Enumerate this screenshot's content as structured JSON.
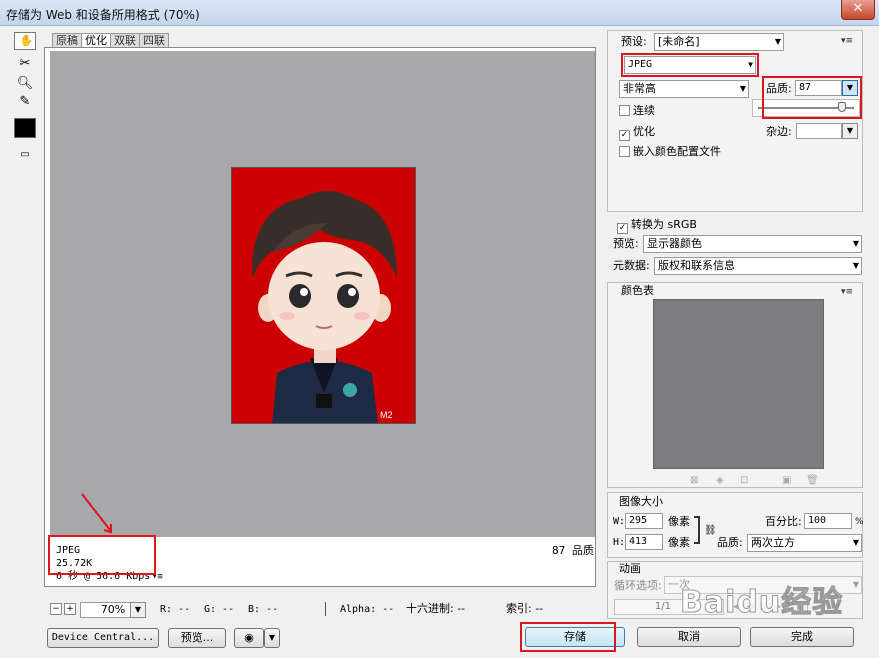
{
  "window": {
    "title": "存储为 Web 和设备所用格式 (70%)"
  },
  "tabs": [
    "原稿",
    "优化",
    "双联",
    "四联"
  ],
  "info": {
    "format": "JPEG",
    "size": "25.72K",
    "speed": "6 秒 @ 56.6 Kbps",
    "quality_note": "87 品质"
  },
  "photo": {
    "corner_mark": "M2"
  },
  "statusbar": {
    "zoom": "70%",
    "r": "R: --",
    "g": "G: --",
    "b": "B: --",
    "alpha": "Alpha: --",
    "hex": "十六进制: --",
    "index": "索引: --"
  },
  "buttons": {
    "device_central": "Device Central...",
    "preview": "预览...",
    "save": "存储",
    "cancel": "取消",
    "done": "完成"
  },
  "settings": {
    "preset_label": "预设:",
    "preset_value": "[未命名]",
    "format": "JPEG",
    "quality_level": "非常高",
    "quality_label": "品质:",
    "quality_value": "87",
    "quality_fraction": 0.87,
    "progressive": "连续",
    "optimized": "优化",
    "embed_profile": "嵌入颜色配置文件",
    "matte_label": "杂边:",
    "convert_srgb": "转换为 sRGB",
    "preview_label": "预览:",
    "preview_value": "显示器颜色",
    "metadata_label": "元数据:",
    "metadata_value": "版权和联系信息"
  },
  "color_table": {
    "title": "颜色表"
  },
  "image_size": {
    "title": "图像大小",
    "w_label": "W:",
    "w_value": "295",
    "w_unit": "像素",
    "h_label": "H:",
    "h_value": "413",
    "h_unit": "像素",
    "percent_label": "百分比:",
    "percent_value": "100",
    "percent_unit": "%",
    "quality_label": "品质:",
    "quality_value": "两次立方"
  },
  "animation": {
    "title": "动画",
    "loop_label": "循环选项:",
    "loop_value": "一次",
    "frame": "1/1"
  },
  "watermark": "Baidu经验",
  "colors": {
    "accent_red": "#e0141e",
    "photo_bg": "#cc0000",
    "canvas": "#a8a7a9",
    "color_table": "#7d7c7e"
  }
}
